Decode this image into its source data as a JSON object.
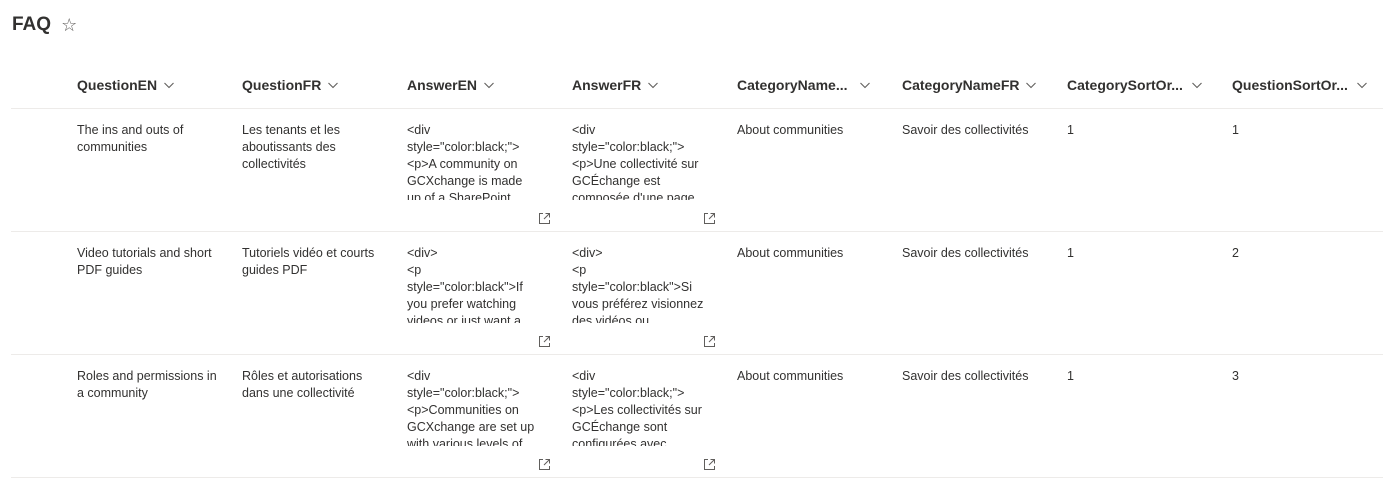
{
  "page": {
    "title": "FAQ",
    "favorite_icon": "star-outline-icon"
  },
  "columns": [
    {
      "label": "QuestionEN"
    },
    {
      "label": "QuestionFR"
    },
    {
      "label": "AnswerEN"
    },
    {
      "label": "AnswerFR"
    },
    {
      "label": "CategoryName..."
    },
    {
      "label": "CategoryNameFR"
    },
    {
      "label": "CategorySortOr..."
    },
    {
      "label": "QuestionSortOr..."
    }
  ],
  "rows": [
    {
      "question_en": "The ins and outs of communities",
      "question_fr": "Les tenants et les aboutissants des collectivités",
      "answer_en": "<div\nstyle=\"color:black;\">\n<p>A community on GCXchange is made up of a SharePoint page and a Teams team for",
      "answer_fr": "<div\nstyle=\"color:black;\">\n<p>Une collectivité sur GCÉchange est composée d'une page SharePoint et d'une équipe",
      "category_en": "About communities",
      "category_fr": "Savoir des collectivités",
      "category_sort": "1",
      "question_sort": "1"
    },
    {
      "question_en": "Video tutorials and short PDF guides",
      "question_fr": "Tutoriels vidéo et courts guides PDF",
      "answer_en": "<div>\n<p\nstyle=\"color:black\">If you prefer watching videos or just want a quick overview of how",
      "answer_fr": "<div>\n<p\nstyle=\"color:black\">Si vous préférez visionnez des vidéos ou simplement avoir un",
      "category_en": "About communities",
      "category_fr": "Savoir des collectivités",
      "category_sort": "1",
      "question_sort": "2"
    },
    {
      "question_en": "Roles and permissions in a community",
      "question_fr": "Rôles et autorisations dans une collectivité",
      "answer_en": "<div\nstyle=\"color:black;\">\n<p>Communities on GCXchange are set up with various levels of permissions and roles",
      "answer_fr": "<div\nstyle=\"color:black;\">\n<p>Les collectivités sur GCÉchange sont configurées avec différents niveaux",
      "category_en": "About communities",
      "category_fr": "Savoir des collectivités",
      "category_sort": "1",
      "question_sort": "3"
    }
  ],
  "icons": {
    "sort": "chevron-down-icon",
    "expand": "open-in-new-window-icon"
  }
}
